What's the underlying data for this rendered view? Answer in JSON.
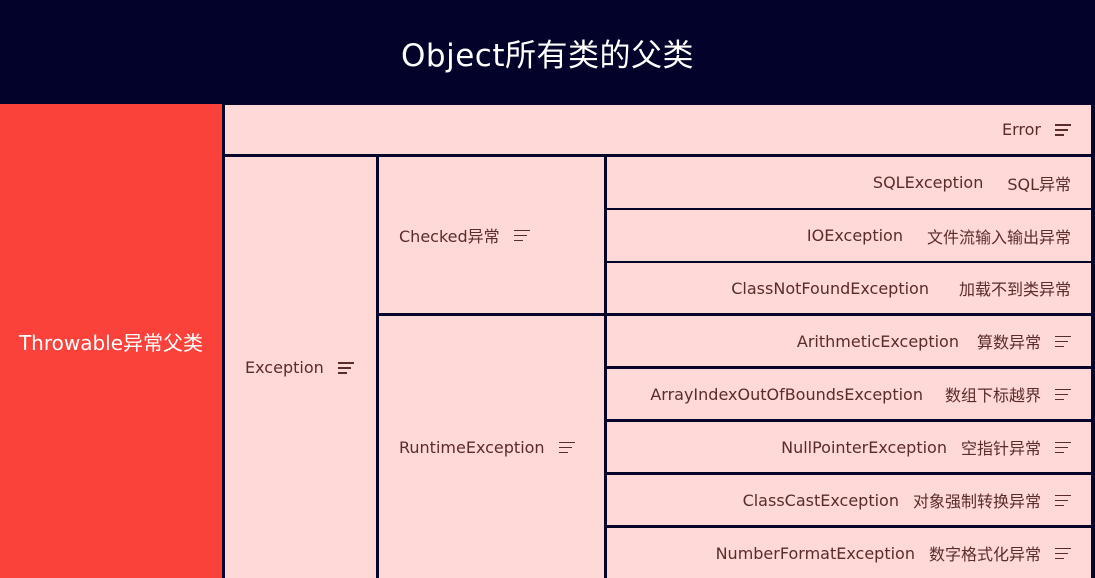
{
  "root": {
    "title": "Object所有类的父类"
  },
  "throwable": {
    "label": "Throwable异常父类"
  },
  "error": {
    "label": "Error"
  },
  "exception": {
    "label": "Exception"
  },
  "checked": {
    "label": "Checked异常",
    "items": [
      {
        "name": "SQLException",
        "desc": "SQL异常"
      },
      {
        "name": "IOException",
        "desc": "文件流输入输出异常"
      },
      {
        "name": "ClassNotFoundException",
        "desc": "加载不到类异常"
      }
    ]
  },
  "runtime": {
    "label": "RuntimeException",
    "items": [
      {
        "name": "ArithmeticException",
        "desc": "算数异常"
      },
      {
        "name": "ArrayIndexOutOfBoundsException",
        "desc": "数组下标越界"
      },
      {
        "name": "NullPointerException",
        "desc": "空指针异常"
      },
      {
        "name": "ClassCastException",
        "desc": "对象强制转换异常"
      },
      {
        "name": "NumberFormatException",
        "desc": "数字格式化异常"
      }
    ]
  },
  "icons": {
    "collapse": "menu-lines-icon"
  },
  "colors": {
    "header": "#02022a",
    "root": "#fb423a",
    "node": "#ffd9d8",
    "border": "#0b0b3a"
  }
}
